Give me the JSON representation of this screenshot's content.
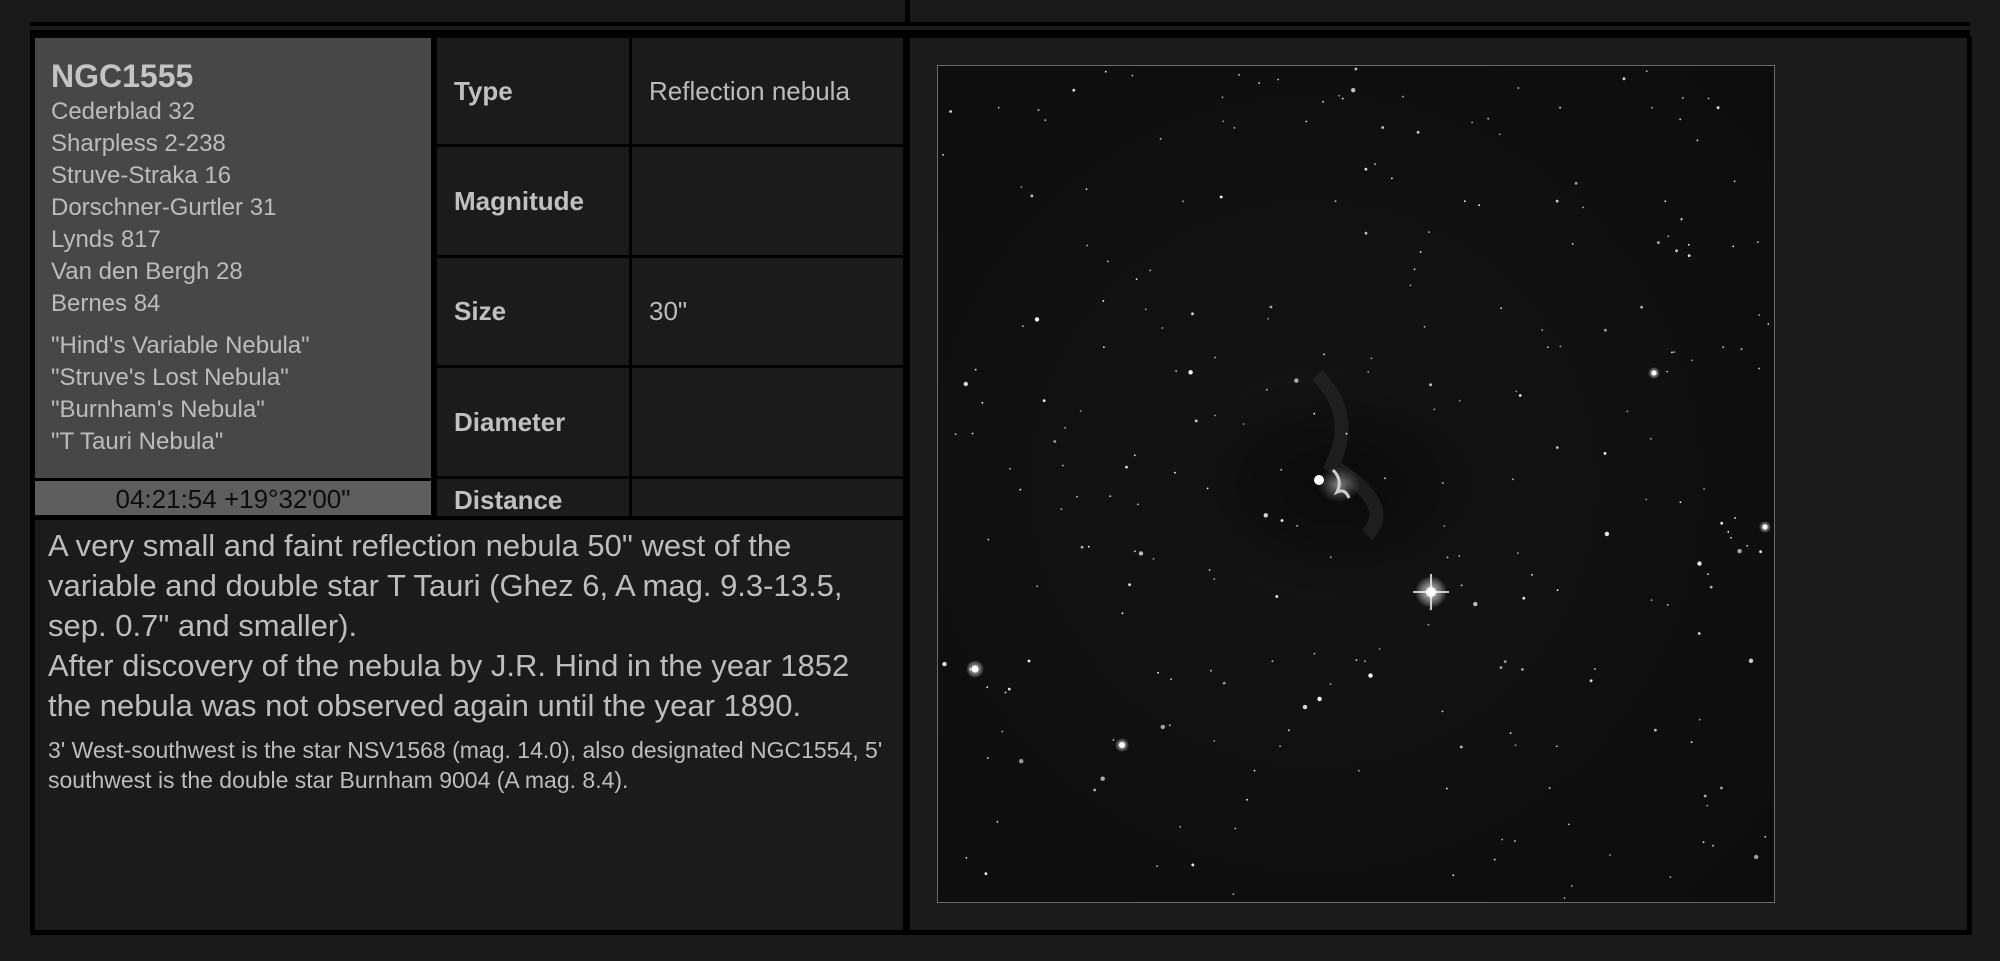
{
  "object": {
    "name": "NGC1555",
    "designations": [
      "Cederblad 32",
      "Sharpless 2-238",
      "Struve-Straka 16",
      "Dorschner-Gurtler 31",
      "Lynds 817",
      "Van den Bergh 28",
      "Bernes 84"
    ],
    "nicknames": [
      "\"Hind's Variable Nebula\"",
      "\"Struve's Lost Nebula\"",
      "\"Burnham's Nebula\"",
      "\"T Tauri Nebula\""
    ],
    "coordinates": "04:21:54 +19°32'00\""
  },
  "properties": {
    "type_label": "Type",
    "type_value": "Reflection nebula",
    "magnitude_label": "Magnitude",
    "magnitude_value": "",
    "size_label": "Size",
    "size_value": "30\"",
    "diameter_label": "Diameter",
    "diameter_value": "",
    "distance_label": "Distance",
    "distance_value": ""
  },
  "description": {
    "para1": "A very small and faint reflection nebula 50\" west of the variable and double star T Tauri (Ghez 6, A mag. 9.3-13.5, sep. 0.7\" and smaller).",
    "para2": "After discovery of the nebula by J.R. Hind in the year 1852 the nebula was not observed again until the year 1890.",
    "note": "3' West-southwest is the star NSV1568 (mag. 14.0), also designated NGC1554, 5' southwest is the double star Burnham 9004 (A mag. 8.4)."
  },
  "colors": {
    "background": "#1a1a1a",
    "frame": "#000000",
    "name_box": "#474747",
    "coord_box": "#5e5e5e",
    "sky": "#0f0f0f"
  }
}
